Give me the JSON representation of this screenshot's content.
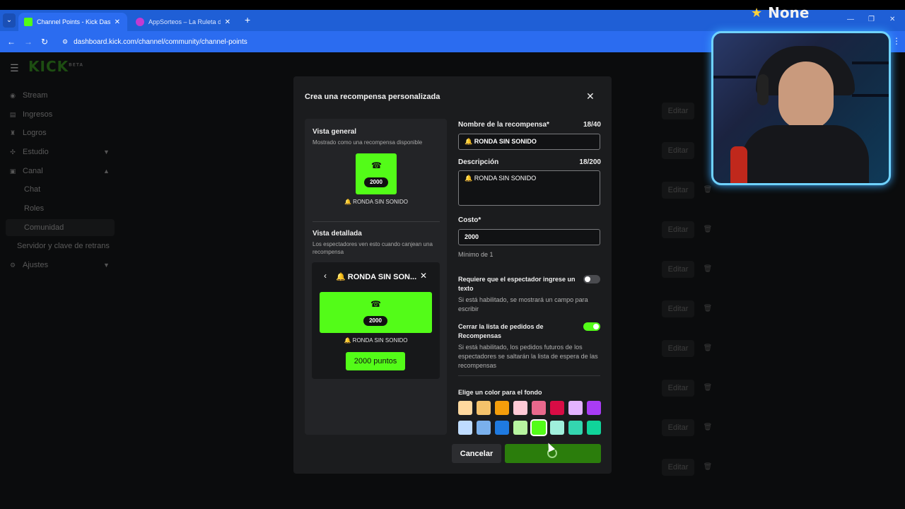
{
  "browser": {
    "tabs": [
      {
        "title": "Channel Points - Kick Dashboard",
        "fav_color": "#53fc18",
        "active": true
      },
      {
        "title": "AppSorteos – La Ruleta de la Suerte",
        "fav_color": "#c23bd1",
        "active": false
      }
    ],
    "url": "dashboard.kick.com/channel/community/channel-points"
  },
  "dashboard": {
    "logo": "KICK",
    "logo_tag": "BETA",
    "sidebar": {
      "items": [
        {
          "label": "Stream",
          "icon": "broadcast-icon"
        },
        {
          "label": "Ingresos",
          "icon": "money-icon"
        },
        {
          "label": "Logros",
          "icon": "trophy-icon"
        },
        {
          "label": "Estudio",
          "icon": "studio-icon"
        },
        {
          "label": "Canal",
          "icon": "channel-icon"
        }
      ],
      "sub_items": [
        "Chat",
        "Roles",
        "Comunidad"
      ],
      "extra": "Servidor y clave de retrans",
      "settings": "Ajustes"
    },
    "row_edit_label": "Editar"
  },
  "modal": {
    "title": "Crea una recompensa personalizada",
    "preview": {
      "overview_heading": "Vista general",
      "overview_sub": "Mostrado como una recompensa disponible",
      "cost": "2000",
      "reward_name_short": "🔔 RONDA SIN SONIDO",
      "detail_heading": "Vista detallada",
      "detail_sub": "Los espectadores ven esto cuando canjean una recompensa",
      "detail_title": "🔔 RONDA SIN SON...",
      "redeem_button": "2000 puntos"
    },
    "form": {
      "name_label": "Nombre de la recompensa*",
      "name_count": "18/40",
      "name_value": "🔔 RONDA SIN SONIDO",
      "desc_label": "Descripción",
      "desc_count": "18/200",
      "desc_value": "🔔 RONDA SIN SONIDO",
      "cost_label": "Costo*",
      "cost_value": "2000",
      "cost_hint": "Mínimo de 1",
      "toggle1_label": "Requiere que el espectador ingrese un texto",
      "toggle1_hint": "Si está habilitado, se mostrará un campo para escribir",
      "toggle1_on": false,
      "toggle2_label": "Cerrar la lista de pedidos de Recompensas",
      "toggle2_hint": "Si está habilitado, los pedidos futuros de los espectadores se saltarán la lista de espera de las recompensas",
      "toggle2_on": true,
      "color_label": "Elige un color para el fondo",
      "colors": [
        "#ffd89e",
        "#f5c26b",
        "#f59e0b",
        "#ffc9d6",
        "#e8688c",
        "#d90c45",
        "#e3b3ff",
        "#a93cf5",
        "#bfdcff",
        "#7ab0ec",
        "#1f7ae0",
        "#b7f5a0",
        "#53fc18",
        "#9ff0dc",
        "#34d6b0",
        "#10d49a"
      ],
      "selected_color_index": 12,
      "cancel_label": "Cancelar"
    }
  },
  "overlay": {
    "badge_text": "None",
    "badge_icon": "star-icon"
  },
  "colors": {
    "accent": "#53fc18",
    "save_button": "#2b7d0c",
    "cam_border": "#6fd2ff"
  }
}
